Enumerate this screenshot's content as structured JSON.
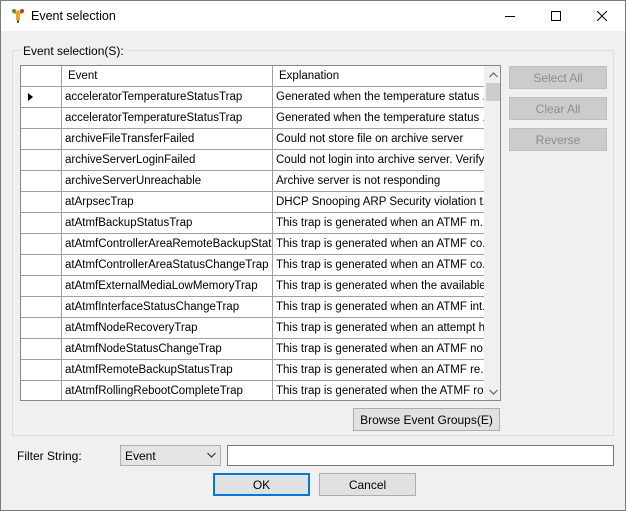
{
  "window": {
    "title": "Event selection",
    "controls": {
      "minimize": "minimize",
      "maximize": "maximize",
      "close": "close"
    }
  },
  "group": {
    "label": "Event selection(S):"
  },
  "grid": {
    "columns": {
      "event": "Event",
      "explanation": "Explanation"
    },
    "rows": [
      {
        "event": "acceleratorTemperatureStatusTrap",
        "explanation": "Generated when the temperature status ...",
        "current": true
      },
      {
        "event": "acceleratorTemperatureStatusTrap",
        "explanation": "Generated when the temperature status ..."
      },
      {
        "event": "archiveFileTransferFailed",
        "explanation": "Could not store file on archive server"
      },
      {
        "event": "archiveServerLoginFailed",
        "explanation": "Could not login into archive server. Verify..."
      },
      {
        "event": "archiveServerUnreachable",
        "explanation": "Archive server is not responding"
      },
      {
        "event": "atArpsecTrap",
        "explanation": "DHCP Snooping ARP Security violation t..."
      },
      {
        "event": "atAtmfBackupStatusTrap",
        "explanation": "This trap is generated when an ATMF m..."
      },
      {
        "event": "atAtmfControllerAreaRemoteBackupStat...",
        "explanation": "This trap is generated when an ATMF co..."
      },
      {
        "event": "atAtmfControllerAreaStatusChangeTrap",
        "explanation": "This trap is generated when an ATMF co..."
      },
      {
        "event": "atAtmfExternalMediaLowMemoryTrap",
        "explanation": "This trap is generated when the available..."
      },
      {
        "event": "atAtmfInterfaceStatusChangeTrap",
        "explanation": "This trap is generated when an ATMF int..."
      },
      {
        "event": "atAtmfNodeRecoveryTrap",
        "explanation": "This trap is generated when an attempt h..."
      },
      {
        "event": "atAtmfNodeStatusChangeTrap",
        "explanation": "This trap is generated when an ATMF no..."
      },
      {
        "event": "atAtmfRemoteBackupStatusTrap",
        "explanation": "This trap is generated when an ATMF re..."
      },
      {
        "event": "atAtmfRollingRebootCompleteTrap",
        "explanation": "This trap is generated when the ATMF ro..."
      }
    ]
  },
  "side_buttons": {
    "select_all": "Select All",
    "clear_all": "Clear All",
    "reverse": "Reverse"
  },
  "browse_button": "Browse Event Groups(E)",
  "filter": {
    "label": "Filter String:",
    "type_value": "Event",
    "text_value": ""
  },
  "footer": {
    "ok": "OK",
    "cancel": "Cancel"
  },
  "colors": {
    "accent": "#0078d7",
    "disabled_text": "#8d8d8d"
  },
  "icons": [
    "app-icon",
    "minimize-icon",
    "maximize-icon",
    "close-icon",
    "current-row-arrow-icon",
    "scroll-up-icon",
    "scroll-down-icon",
    "chevron-down-icon"
  ]
}
